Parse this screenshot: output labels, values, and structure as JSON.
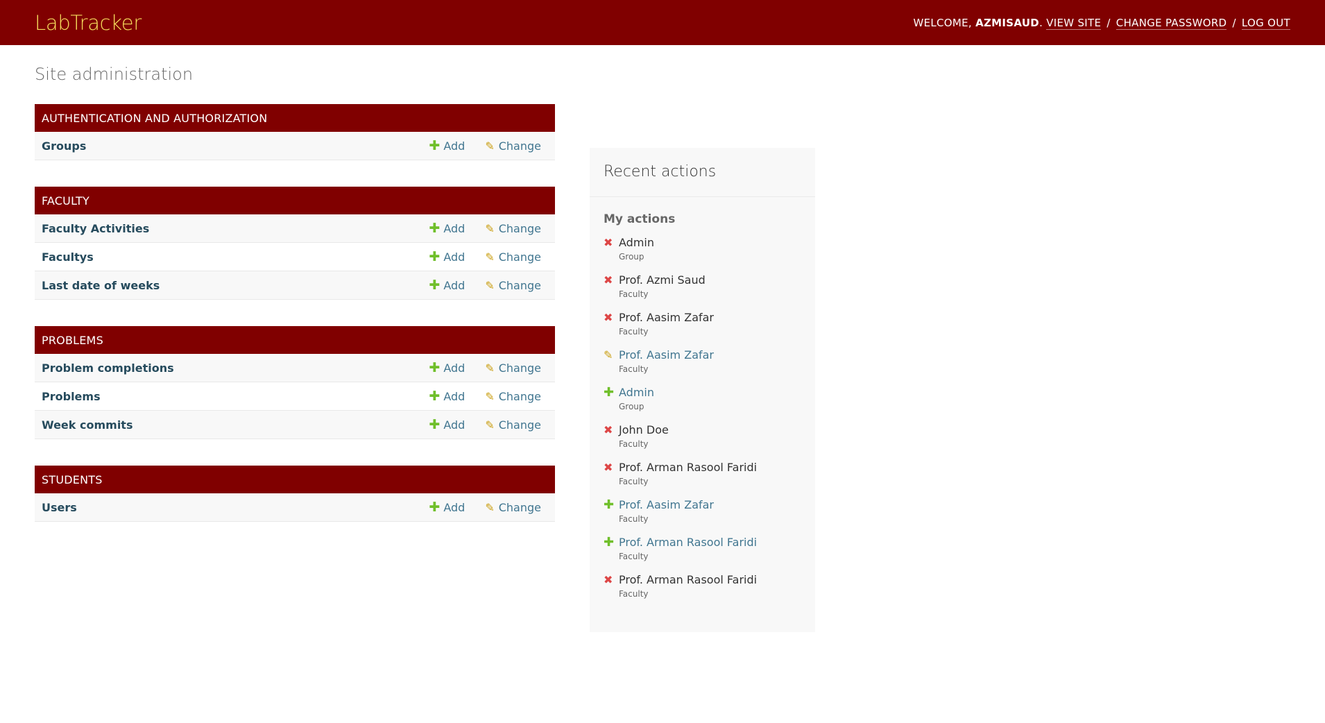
{
  "header": {
    "brand": "LabTracker",
    "welcome": "WELCOME,",
    "username": "AZMISAUD",
    "period": ".",
    "view_site": "VIEW SITE",
    "change_password": "CHANGE PASSWORD",
    "log_out": "LOG OUT",
    "separator": "/"
  },
  "page": {
    "title": "Site administration"
  },
  "labels": {
    "add": "Add",
    "change": "Change"
  },
  "icons": {
    "add": "plus-icon",
    "change": "pencil-icon",
    "delete": "x-icon"
  },
  "colors": {
    "header_bg": "#800000",
    "brand": "#f5dd5d",
    "add": "#70bf2b",
    "change": "#c99e10",
    "delete": "#dd4646",
    "link": "#417690"
  },
  "modules": [
    {
      "caption": "AUTHENTICATION AND AUTHORIZATION",
      "models": [
        {
          "name": "Groups"
        }
      ]
    },
    {
      "caption": "FACULTY",
      "models": [
        {
          "name": "Faculty Activities"
        },
        {
          "name": "Facultys"
        },
        {
          "name": "Last date of weeks"
        }
      ]
    },
    {
      "caption": "PROBLEMS",
      "models": [
        {
          "name": "Problem completions"
        },
        {
          "name": "Problems"
        },
        {
          "name": "Week commits"
        }
      ]
    },
    {
      "caption": "STUDENTS",
      "models": [
        {
          "name": "Users"
        }
      ]
    }
  ],
  "recent": {
    "title": "Recent actions",
    "subtitle": "My actions",
    "actions": [
      {
        "kind": "delete",
        "name": "Admin",
        "type": "Group"
      },
      {
        "kind": "delete",
        "name": "Prof. Azmi Saud",
        "type": "Faculty"
      },
      {
        "kind": "delete",
        "name": "Prof. Aasim Zafar",
        "type": "Faculty"
      },
      {
        "kind": "change",
        "name": "Prof. Aasim Zafar",
        "type": "Faculty"
      },
      {
        "kind": "add",
        "name": "Admin",
        "type": "Group"
      },
      {
        "kind": "delete",
        "name": "John Doe",
        "type": "Faculty"
      },
      {
        "kind": "delete",
        "name": "Prof. Arman Rasool Faridi",
        "type": "Faculty"
      },
      {
        "kind": "add",
        "name": "Prof. Aasim Zafar",
        "type": "Faculty"
      },
      {
        "kind": "add",
        "name": "Prof. Arman Rasool Faridi",
        "type": "Faculty"
      },
      {
        "kind": "delete",
        "name": "Prof. Arman Rasool Faridi",
        "type": "Faculty"
      }
    ]
  }
}
